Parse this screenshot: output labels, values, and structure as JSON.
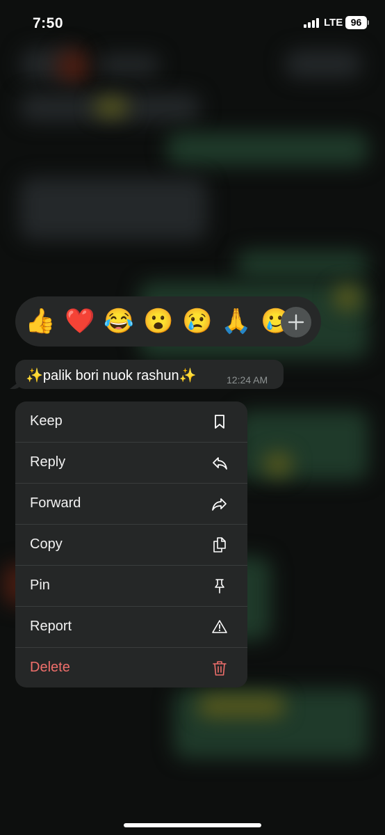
{
  "status_bar": {
    "time": "7:50",
    "network": "LTE",
    "battery": "96"
  },
  "reactions": {
    "emojis": [
      "👍",
      "❤️",
      "😂",
      "😮",
      "😢",
      "🙏",
      "🥲"
    ],
    "more_icon": "plus-icon"
  },
  "message": {
    "text": "✨palik bori nuok rashun✨",
    "time": "12:24 AM"
  },
  "menu": {
    "items": [
      {
        "label": "Keep",
        "icon": "bookmark-icon"
      },
      {
        "label": "Reply",
        "icon": "reply-icon"
      },
      {
        "label": "Forward",
        "icon": "forward-icon"
      },
      {
        "label": "Copy",
        "icon": "copy-icon"
      },
      {
        "label": "Pin",
        "icon": "pin-icon"
      },
      {
        "label": "Report",
        "icon": "warning-icon"
      },
      {
        "label": "Delete",
        "icon": "trash-icon"
      }
    ]
  },
  "colors": {
    "menu_bg": "#252727",
    "destructive": "#ef6f6b"
  }
}
